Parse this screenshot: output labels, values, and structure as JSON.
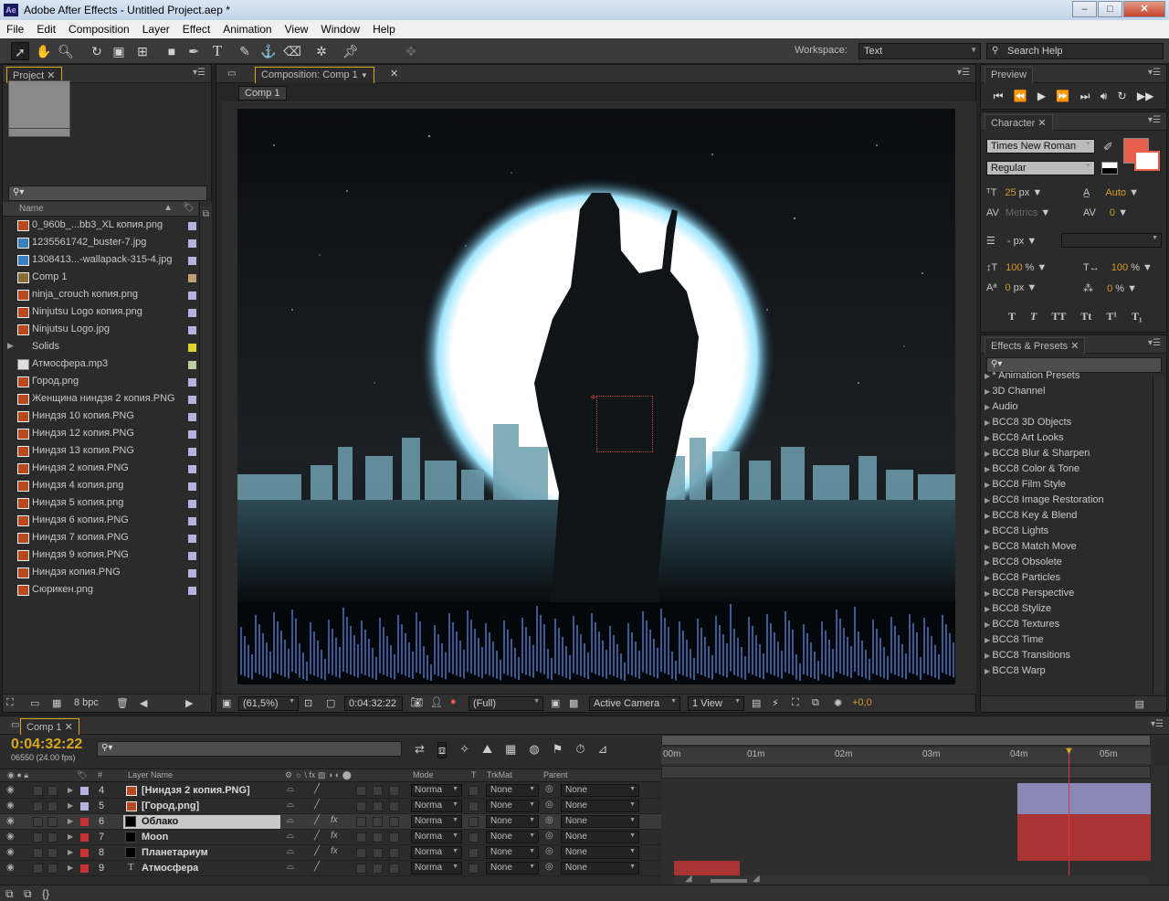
{
  "window": {
    "title": "Adobe After Effects - Untitled Project.aep *",
    "logo": "Ae"
  },
  "menu": [
    "File",
    "Edit",
    "Composition",
    "Layer",
    "Effect",
    "Animation",
    "View",
    "Window",
    "Help"
  ],
  "toolbar": {
    "workspace_label": "Workspace:",
    "workspace_value": "Text",
    "search_help": "Search Help"
  },
  "project": {
    "tab": "Project",
    "name_header": "Name",
    "bpc": "8 bpc",
    "items": [
      {
        "name": "0_960b_...bb3_XL копия.png",
        "type": "png"
      },
      {
        "name": "1235561742_buster-7.jpg",
        "type": "img"
      },
      {
        "name": "1308413...-wallapack-315-4.jpg",
        "type": "img"
      },
      {
        "name": "Comp 1",
        "type": "comp"
      },
      {
        "name": "ninja_crouch копия.png",
        "type": "png"
      },
      {
        "name": "Ninjutsu Logo копия.png",
        "type": "png"
      },
      {
        "name": "Ninjutsu Logo.jpg",
        "type": "png"
      },
      {
        "name": "Solids",
        "type": "folder"
      },
      {
        "name": "Атмосфера.mp3",
        "type": "audio"
      },
      {
        "name": "Город.png",
        "type": "png"
      },
      {
        "name": "Женщина ниндзя 2 копия.PNG",
        "type": "png"
      },
      {
        "name": "Ниндзя 10 копия.PNG",
        "type": "png"
      },
      {
        "name": "Ниндзя 12 копия.PNG",
        "type": "png"
      },
      {
        "name": "Ниндзя 13 копия.PNG",
        "type": "png"
      },
      {
        "name": "Ниндзя 2 копия.PNG",
        "type": "png"
      },
      {
        "name": "Ниндзя 4 копия.png",
        "type": "png"
      },
      {
        "name": "Ниндзя 5 копия.png",
        "type": "png"
      },
      {
        "name": "Ниндзя 6 копия.PNG",
        "type": "png"
      },
      {
        "name": "Ниндзя 7 копия.PNG",
        "type": "png"
      },
      {
        "name": "Ниндзя 9 копия.PNG",
        "type": "png"
      },
      {
        "name": "Ниндзя копия.PNG",
        "type": "png"
      },
      {
        "name": "Сюрикен.png",
        "type": "png"
      }
    ]
  },
  "composition": {
    "tab": "Composition: Comp 1",
    "comp_button": "Comp 1",
    "zoom": "(61,5%)",
    "timecode": "0:04:32:22",
    "resolution": "(Full)",
    "camera": "Active Camera",
    "views": "1 View",
    "exposure": "+0,0"
  },
  "preview": {
    "tab": "Preview"
  },
  "character": {
    "tab": "Character",
    "font": "Times New Roman",
    "style": "Regular",
    "size": "25",
    "size_unit": "px",
    "leading": "Auto",
    "kerning": "Metrics",
    "tracking": "0",
    "stroke_unit": "px",
    "vscale": "100",
    "hscale": "100",
    "pct": "%",
    "baseline": "0",
    "baseline_unit": "px",
    "tsume": "0",
    "tsume_unit": "%",
    "fill_color": "#e8604c",
    "styles": [
      "T",
      "T",
      "TT",
      "Tt",
      "T¹",
      "T₁"
    ]
  },
  "effects": {
    "tab": "Effects & Presets",
    "items": [
      "* Animation Presets",
      "3D Channel",
      "Audio",
      "BCC8 3D Objects",
      "BCC8 Art Looks",
      "BCC8 Blur & Sharpen",
      "BCC8 Color & Tone",
      "BCC8 Film Style",
      "BCC8 Image Restoration",
      "BCC8 Key & Blend",
      "BCC8 Lights",
      "BCC8 Match Move",
      "BCC8 Obsolete",
      "BCC8 Particles",
      "BCC8 Perspective",
      "BCC8 Stylize",
      "BCC8 Textures",
      "BCC8 Time",
      "BCC8 Transitions",
      "BCC8 Warp"
    ]
  },
  "timeline": {
    "tab": "Comp 1",
    "time": "0:04:32:22",
    "frames": "06550 (24.00 fps)",
    "headers": {
      "layer_name": "Layer Name",
      "mode": "Mode",
      "t": "T",
      "trkmat": "TrkMat",
      "parent": "Parent",
      "num": "#"
    },
    "ruler": [
      "00m",
      "01m",
      "02m",
      "03m",
      "04m",
      "05m"
    ],
    "layers": [
      {
        "num": "4",
        "name": "[Ниндзя 2 копия.PNG]",
        "label": "#b4b4e0",
        "mode": "Norma",
        "trk": "None",
        "parent": "None",
        "fx": false
      },
      {
        "num": "5",
        "name": "[Город.png]",
        "label": "#b4b4e0",
        "mode": "Norma",
        "trk": "None",
        "parent": "None",
        "fx": false
      },
      {
        "num": "6",
        "name": "Облако",
        "label": "#c83232",
        "mode": "Norma",
        "trk": "None",
        "parent": "None",
        "fx": true
      },
      {
        "num": "7",
        "name": "Moon",
        "label": "#c83232",
        "mode": "Norma",
        "trk": "None",
        "parent": "None",
        "fx": true
      },
      {
        "num": "8",
        "name": "Планетариум",
        "label": "#c83232",
        "mode": "Norma",
        "trk": "None",
        "parent": "None",
        "fx": true
      },
      {
        "num": "9",
        "name": "Атмосфера",
        "label": "#c83232",
        "mode": "Norma",
        "trk": "None",
        "parent": "None",
        "fx": false
      }
    ]
  },
  "colors": {
    "accent": "#d8a81c",
    "playhead": "#c83232"
  }
}
